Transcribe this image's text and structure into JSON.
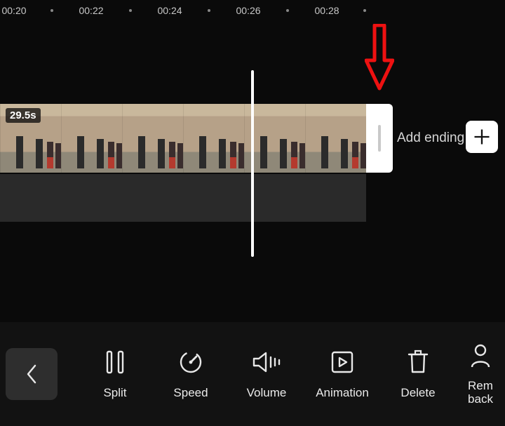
{
  "ruler": {
    "ticks": [
      "00:20",
      "00:22",
      "00:24",
      "00:26",
      "00:28"
    ]
  },
  "clip": {
    "duration": "29.5s"
  },
  "add_ending_label": "Add ending",
  "toolbar": {
    "split": "Split",
    "speed": "Speed",
    "volume": "Volume",
    "animation": "Animation",
    "delete": "Delete",
    "remove_bg_line1": "Rem",
    "remove_bg_line2": "back"
  }
}
